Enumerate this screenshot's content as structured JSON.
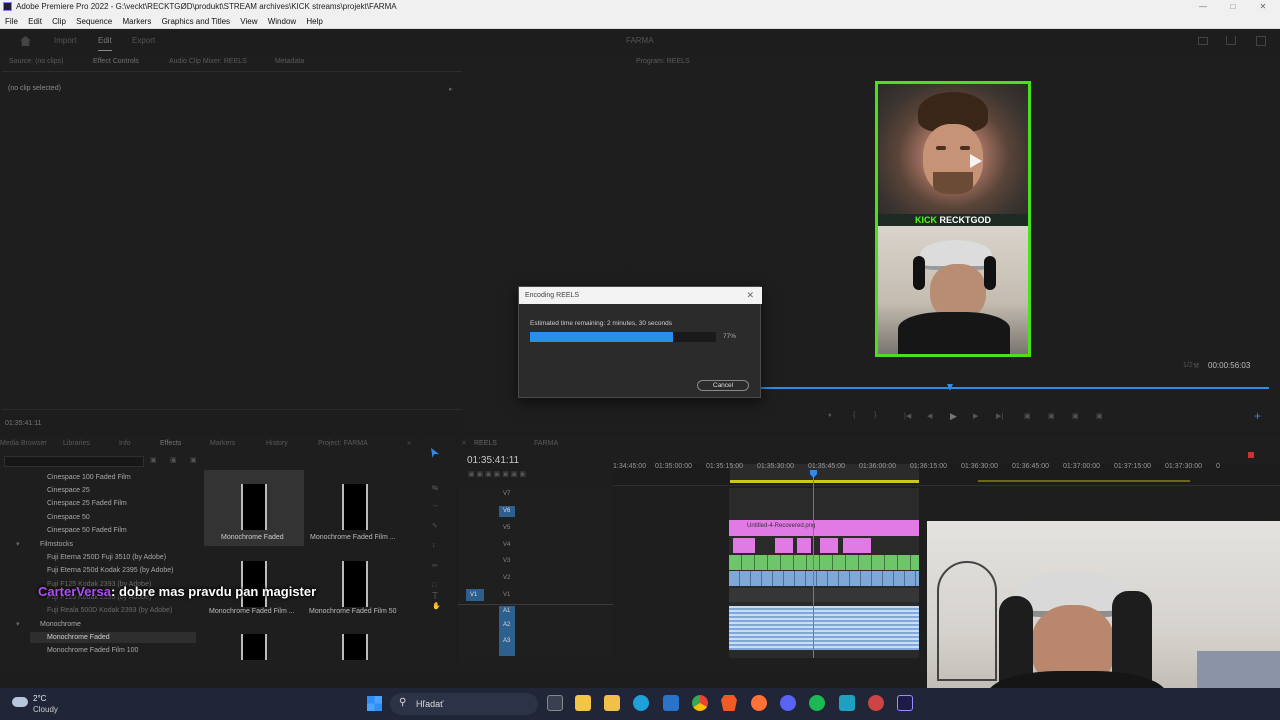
{
  "window": {
    "title": "Adobe Premiere Pro 2022 - G:\\veckt\\RECKTGØD\\produkt\\STREAM archives\\KICK streams\\projekt\\FARMA"
  },
  "menu": [
    "File",
    "Edit",
    "Clip",
    "Sequence",
    "Markers",
    "Graphics and Titles",
    "View",
    "Window",
    "Help"
  ],
  "workspace": {
    "tabs": [
      "Import",
      "Edit",
      "Export"
    ],
    "project_name": "FARMA"
  },
  "source_panel": {
    "tabs": [
      "Source: (no clips)",
      "Effect Controls",
      "Audio Clip Mixer: REELS",
      "Metadata"
    ],
    "no_clip": "(no clip selected)",
    "timecode": "01:35:41:11"
  },
  "program_panel": {
    "tab": "Program: REELS",
    "overlay_brand": "KICK",
    "overlay_name": "RECKTGOD",
    "fit_label": "1/2",
    "duration": "00:00:56:03"
  },
  "encoding_dialog": {
    "title": "Encoding REELS",
    "message": "Estimated time remaining: 2 minutes, 30 seconds",
    "progress_percent": 77,
    "progress_label": "77%",
    "cancel_label": "Cancel"
  },
  "effects_panel": {
    "tabs": [
      "Media Browser",
      "Libraries",
      "Info",
      "Effects",
      "Markers",
      "History",
      "Project: FARMA"
    ],
    "list": [
      "Cinespace 100 Faded Film",
      "Cinespace 25",
      "Cinespace 25 Faded Film",
      "Cinespace 50",
      "Cinespace 50 Faded Film",
      "Filmstocks",
      "Fuji Eterna 250D Fuji 3510 (by Adobe)",
      "Fuji Eterna 250d Kodak 2395 (by Adobe)",
      "Fuji F125 Kodak 2393 (by Adobe)",
      "Fuji F125 Kodak 2395 (by Adobe)",
      "Fuji Reala 500D Kodak 2393 (by Adobe)",
      "Monochrome",
      "Monochrome Faded",
      "Monochrome Faded Film 100"
    ],
    "thumbs": [
      "Monochrome Faded",
      "Monochrome Faded Film ...",
      "Monochrome Faded Film ...",
      "Monochrome Faded Film 50"
    ]
  },
  "chat_overlay": {
    "user": "CarterVersa",
    "message": ": dobre mas pravdu pan magister"
  },
  "timeline": {
    "tabs": [
      "REELS",
      "FARMA"
    ],
    "timecode": "01:35:41:11",
    "ruler": [
      "1:34:45:00",
      "01:35:00:00",
      "01:35:15:00",
      "01:35:30:00",
      "01:35:45:00",
      "01:36:00:00",
      "01:36:15:00",
      "01:36:30:00",
      "01:36:45:00",
      "01:37:00:00",
      "01:37:15:00",
      "01:37:30:00",
      "0"
    ],
    "video_tracks": [
      "V7",
      "V6",
      "V5",
      "V4",
      "V3",
      "V2",
      "V1"
    ],
    "audio_tracks": [
      "A1",
      "A2",
      "A3"
    ],
    "clip_label": "Untitled-4-Recovered.png",
    "source_patch_v": "V1",
    "source_patch_a": "A1"
  },
  "taskbar": {
    "temperature": "2°C",
    "weather": "Cloudy",
    "search_placeholder": "Hľadať"
  },
  "colors": {
    "accent_blue": "#2d8ceb",
    "clip_pink": "#e27ae6",
    "clip_green": "#6fc56a",
    "clip_blue": "#7fa8d8",
    "kick_green": "#53fc18",
    "overlay_border": "#4ae01d"
  }
}
